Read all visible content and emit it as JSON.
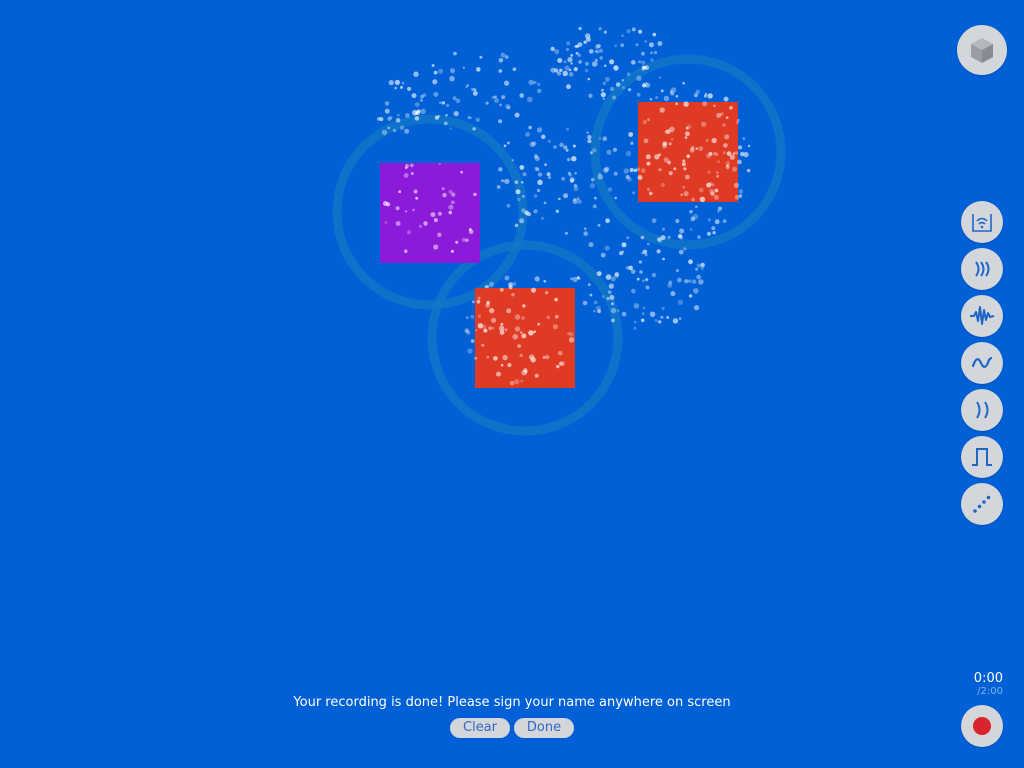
{
  "canvas": {
    "background": "#0160d6",
    "shapes": [
      {
        "name": "purple-square",
        "color": "#8b1ad9"
      },
      {
        "name": "red-square-top",
        "color": "#de3a24"
      },
      {
        "name": "red-square-bottom",
        "color": "#de3a24"
      }
    ],
    "ring_color": "#1276c8"
  },
  "toolbar": {
    "top_button_icon": "cube-icon",
    "effects": [
      {
        "icon": "wifi-box-icon",
        "label": "wifi-box"
      },
      {
        "icon": "triple-wave-icon",
        "label": "triple-wave"
      },
      {
        "icon": "waveform-icon",
        "label": "waveform"
      },
      {
        "icon": "sine-wave-icon",
        "label": "sine-wave"
      },
      {
        "icon": "double-wave-icon",
        "label": "double-wave"
      },
      {
        "icon": "square-wave-icon",
        "label": "square-wave"
      },
      {
        "icon": "dotted-line-icon",
        "label": "dotted-line"
      }
    ],
    "accent": "#1f66c8"
  },
  "timer": {
    "current": "0:00",
    "total": "/2:00"
  },
  "recording": {
    "message": "Your recording is done! Please sign your name anywhere on screen",
    "clear_label": "Clear",
    "done_label": "Done",
    "record_color": "#d9232d"
  }
}
